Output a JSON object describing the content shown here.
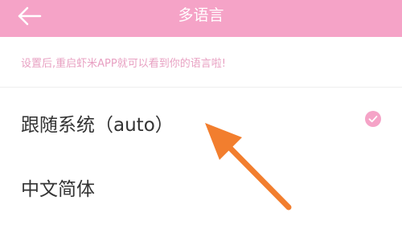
{
  "header": {
    "title": "多语言",
    "back_icon": "back-arrow-icon",
    "background_color": "#f5a3c7"
  },
  "hint": {
    "text": "设置后,重启虾米APP就可以看到你的语言啦!"
  },
  "options": [
    {
      "label": "跟随系统（auto）",
      "selected": true,
      "icon": "check-icon"
    },
    {
      "label": "中文简体",
      "selected": false
    }
  ],
  "annotation": {
    "icon": "orange-arrow-icon",
    "color": "#f27e2e"
  },
  "colors": {
    "accent": "#f5a3c7",
    "hint_text": "#e8a0c2"
  }
}
